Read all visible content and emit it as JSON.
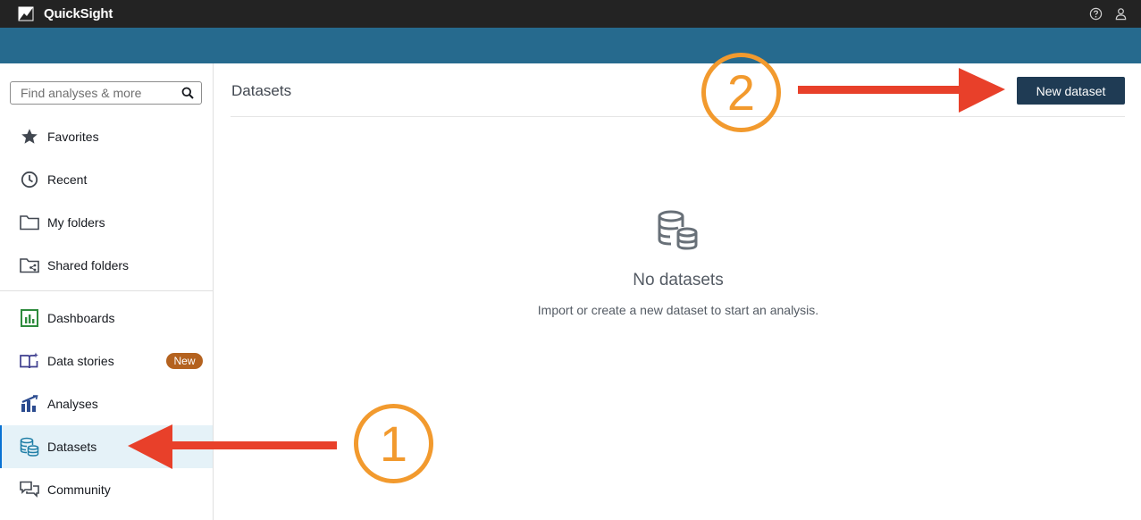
{
  "app": {
    "name": "QuickSight"
  },
  "topbar": {
    "icons": [
      "help-icon",
      "user-icon"
    ]
  },
  "search": {
    "placeholder": "Find analyses & more"
  },
  "sidebar": {
    "items": [
      {
        "label": "Favorites",
        "icon": "star-icon"
      },
      {
        "label": "Recent",
        "icon": "clock-icon"
      },
      {
        "label": "My folders",
        "icon": "folder-icon"
      },
      {
        "label": "Shared folders",
        "icon": "shared-folder-icon"
      },
      {
        "label": "Dashboards",
        "icon": "dashboard-icon"
      },
      {
        "label": "Data stories",
        "icon": "data-stories-icon",
        "badge": "New"
      },
      {
        "label": "Analyses",
        "icon": "analyses-icon"
      },
      {
        "label": "Datasets",
        "icon": "datasets-icon",
        "active": true
      },
      {
        "label": "Community",
        "icon": "community-icon"
      }
    ]
  },
  "main": {
    "title": "Datasets",
    "new_dataset_label": "New dataset",
    "empty": {
      "icon": "database-icon",
      "title": "No datasets",
      "subtitle": "Import or create a new dataset to start an analysis."
    }
  },
  "annotations": [
    {
      "number": "1",
      "target": "Datasets"
    },
    {
      "number": "2",
      "target": "New dataset"
    }
  ],
  "colors": {
    "topbar": "#232323",
    "banner": "#266a8e",
    "button": "#1f3b54",
    "badge": "#b4621f",
    "active_bg": "#e5f2f8",
    "annotation_circle": "#f29a2e",
    "annotation_arrow": "#e8402a"
  }
}
